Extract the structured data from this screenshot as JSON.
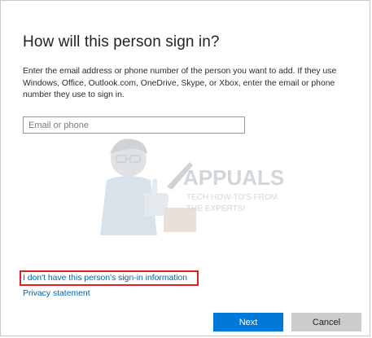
{
  "dialog": {
    "title": "How will this person sign in?",
    "description": "Enter the email address or phone number of the person you want to add. If they use Windows, Office, Outlook.com, OneDrive, Skype, or Xbox, enter the email or phone number they use to sign in.",
    "input": {
      "value": "",
      "placeholder": "Email or phone"
    },
    "no_info_link": "I don't have this person's sign-in information",
    "privacy_link": "Privacy statement",
    "next_label": "Next",
    "cancel_label": "Cancel"
  },
  "watermark": {
    "brand": "APPUALS",
    "tagline_line1": "TECH HOW-TO'S FROM",
    "tagline_line2": "THE EXPERTS!"
  },
  "colors": {
    "accent": "#0078d7",
    "link": "#0063b1",
    "highlight_box": "#e02020",
    "cancel_bg": "#cccccc"
  }
}
